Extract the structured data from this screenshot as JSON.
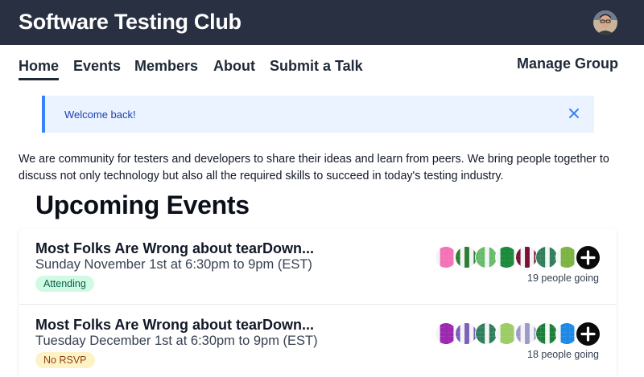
{
  "header": {
    "title": "Software Testing Club",
    "avatar_icon": "user-avatar"
  },
  "nav": {
    "items": [
      {
        "label": "Home",
        "active": true
      },
      {
        "label": "Events"
      },
      {
        "label": "Members"
      },
      {
        "label": "About"
      },
      {
        "label": "Submit a Talk"
      }
    ],
    "manage_label": "Manage Group"
  },
  "alert": {
    "text": "Welcome back!",
    "close_icon": "close-icon"
  },
  "intro": "We are community for testers and developers to share their ideas and learn from peers. We bring people together to discuss not only technology but also all the required skills to succeed in today's testing industry.",
  "events_heading": "Upcoming Events",
  "events": [
    {
      "title": "Most Folks Are Wrong about tearDown...",
      "date": "Sunday November 1st at 6:30pm to 9pm (EST)",
      "status": "Attending",
      "going": "19 people going",
      "avatar_colors": [
        "#f472b6",
        "#2e7d32",
        "#66bb6a",
        "#1b8a3a",
        "#7b1034",
        "#2e7d5b",
        "#7cb342"
      ]
    },
    {
      "title": "Most Folks Are Wrong about tearDown...",
      "date": "Tuesday December 1st at 6:30pm to 9pm (EST)",
      "status": "No RSVP",
      "going": "18 people going",
      "avatar_colors": [
        "#9c27b0",
        "#7b5fb8",
        "#2e7d5b",
        "#9ccc65",
        "#9e9ac8",
        "#1b7f3a",
        "#1e88e5"
      ]
    }
  ],
  "colors": {
    "topbar": "#283041",
    "alert_bg": "#eaf3ff",
    "alert_border": "#3b82f6",
    "attending": "#d1fae5",
    "norsvp": "#fef3c7"
  }
}
